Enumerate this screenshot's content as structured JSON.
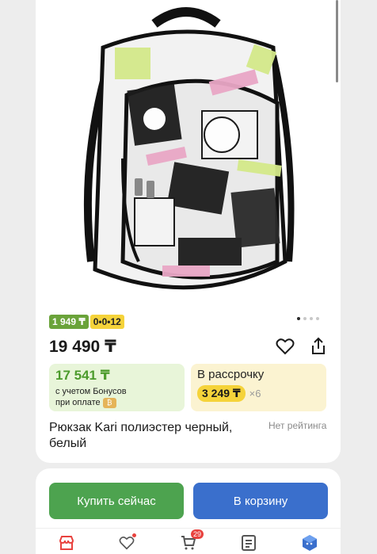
{
  "product": {
    "image_alt": "Рюкзак с рисунком аниме",
    "carousel_dots": 4,
    "carousel_active": 1,
    "badge_green": "1 949 ₸",
    "badge_yellow": "0•0•12",
    "price": "19 490 ₸",
    "name": "Рюкзак Kari полиэстер черный, белый",
    "rating": "Нет рейтинга"
  },
  "bonus": {
    "price": "17 541 ₸",
    "note_line1": "с учетом Бонусов",
    "note_line2": "при оплате"
  },
  "installment": {
    "title": "В рассрочку",
    "amount": "3 249 ₸",
    "multiplier": "×6"
  },
  "actions": {
    "buy_label": "Купить сейчас",
    "cart_label": "В корзину"
  },
  "nav": {
    "cart_count": "29"
  },
  "colors": {
    "bonus_green": "#4c9b2c",
    "buy_green": "#4da34f",
    "cart_blue": "#3a6fcc",
    "yellow": "#f5d33a"
  }
}
